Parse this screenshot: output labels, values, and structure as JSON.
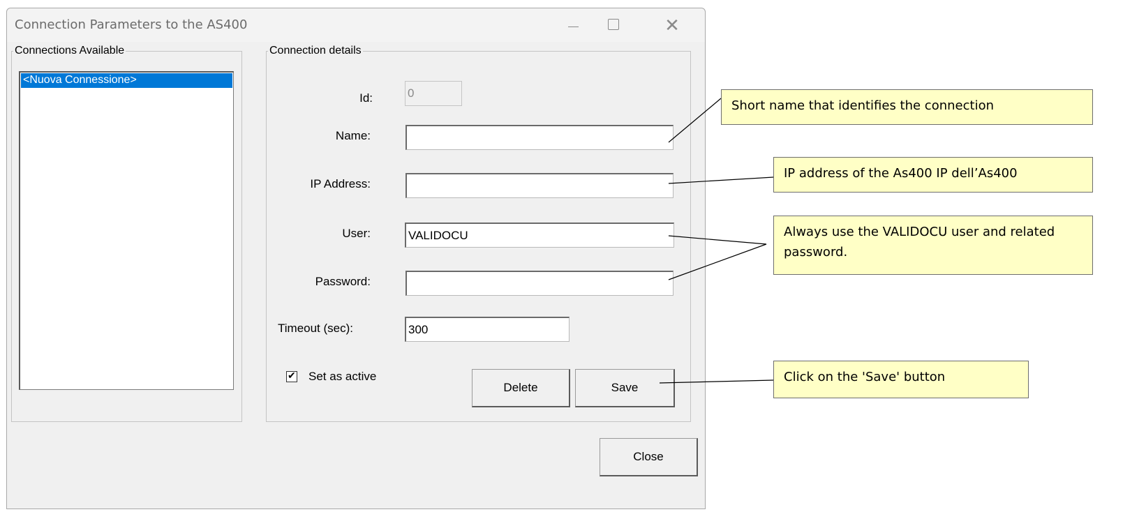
{
  "window": {
    "title": "Connection Parameters to the AS400",
    "minimize_icon": "minimize-icon",
    "maximize_icon": "maximize-icon",
    "close_glyph": "✕"
  },
  "connections_group": {
    "legend": "Connections Available",
    "items": [
      "<Nuova Connessione>"
    ],
    "selected_index": 0
  },
  "details_group": {
    "legend": "Connection details",
    "id": {
      "label": "Id:",
      "value": "0"
    },
    "name": {
      "label": "Name:",
      "value": ""
    },
    "ip": {
      "label": "IP Address:",
      "value": ""
    },
    "user": {
      "label": "User:",
      "value": "VALIDOCU"
    },
    "password": {
      "label": "Password:",
      "value": ""
    },
    "timeout": {
      "label": "Timeout (sec):",
      "value": "300"
    },
    "active": {
      "label": "Set as active",
      "checked": true
    },
    "delete_label": "Delete",
    "save_label": "Save"
  },
  "close_label": "Close",
  "callouts": {
    "name": "Short name that identifies the connection",
    "ip": "IP address of the As400 IP dell’As400",
    "user": "Always use the VALIDOCU user and related password.",
    "save": "Click on the 'Save' button"
  }
}
